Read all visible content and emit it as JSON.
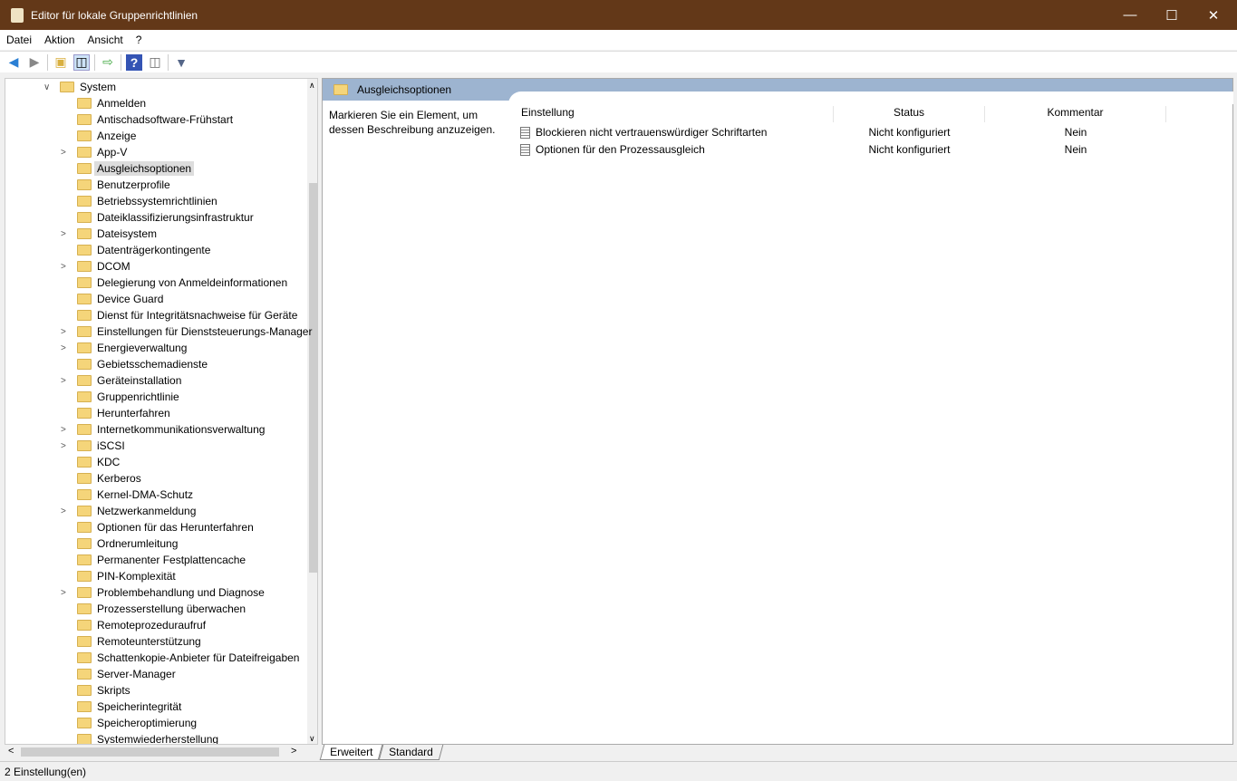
{
  "window": {
    "title": "Editor für lokale Gruppenrichtlinien"
  },
  "menu": [
    "Datei",
    "Aktion",
    "Ansicht",
    "?"
  ],
  "tree": {
    "root": "System",
    "items": [
      {
        "label": "Anmelden",
        "expandable": false
      },
      {
        "label": "Antischadsoftware-Frühstart",
        "expandable": false
      },
      {
        "label": "Anzeige",
        "expandable": false
      },
      {
        "label": "App-V",
        "expandable": true
      },
      {
        "label": "Ausgleichsoptionen",
        "expandable": false,
        "selected": true
      },
      {
        "label": "Benutzerprofile",
        "expandable": false
      },
      {
        "label": "Betriebssystemrichtlinien",
        "expandable": false
      },
      {
        "label": "Dateiklassifizierungsinfrastruktur",
        "expandable": false
      },
      {
        "label": "Dateisystem",
        "expandable": true
      },
      {
        "label": "Datenträgerkontingente",
        "expandable": false
      },
      {
        "label": "DCOM",
        "expandable": true
      },
      {
        "label": "Delegierung von Anmeldeinformationen",
        "expandable": false
      },
      {
        "label": "Device Guard",
        "expandable": false
      },
      {
        "label": "Dienst für Integritätsnachweise für Geräte",
        "expandable": false
      },
      {
        "label": "Einstellungen für Dienststeuerungs-Manager",
        "expandable": true
      },
      {
        "label": "Energieverwaltung",
        "expandable": true
      },
      {
        "label": "Gebietsschemadienste",
        "expandable": false
      },
      {
        "label": "Geräteinstallation",
        "expandable": true
      },
      {
        "label": "Gruppenrichtlinie",
        "expandable": false
      },
      {
        "label": "Herunterfahren",
        "expandable": false
      },
      {
        "label": "Internetkommunikationsverwaltung",
        "expandable": true
      },
      {
        "label": "iSCSI",
        "expandable": true
      },
      {
        "label": "KDC",
        "expandable": false
      },
      {
        "label": "Kerberos",
        "expandable": false
      },
      {
        "label": "Kernel-DMA-Schutz",
        "expandable": false
      },
      {
        "label": "Netzwerkanmeldung",
        "expandable": true
      },
      {
        "label": "Optionen für das Herunterfahren",
        "expandable": false
      },
      {
        "label": "Ordnerumleitung",
        "expandable": false
      },
      {
        "label": "Permanenter Festplattencache",
        "expandable": false
      },
      {
        "label": "PIN-Komplexität",
        "expandable": false
      },
      {
        "label": "Problembehandlung und Diagnose",
        "expandable": true
      },
      {
        "label": "Prozesserstellung überwachen",
        "expandable": false
      },
      {
        "label": "Remoteprozeduraufruf",
        "expandable": false
      },
      {
        "label": "Remoteunterstützung",
        "expandable": false
      },
      {
        "label": "Schattenkopie-Anbieter für Dateifreigaben",
        "expandable": false
      },
      {
        "label": "Server-Manager",
        "expandable": false
      },
      {
        "label": "Skripts",
        "expandable": false
      },
      {
        "label": "Speicherintegrität",
        "expandable": false
      },
      {
        "label": "Speicheroptimierung",
        "expandable": false
      },
      {
        "label": "Systemwiederherstellung",
        "expandable": false
      }
    ]
  },
  "main": {
    "header": "Ausgleichsoptionen",
    "description": "Markieren Sie ein Element, um dessen Beschreibung anzuzeigen.",
    "columns": [
      "Einstellung",
      "Status",
      "Kommentar"
    ],
    "rows": [
      {
        "setting": "Blockieren nicht vertrauenswürdiger Schriftarten",
        "status": "Nicht konfiguriert",
        "comment": "Nein"
      },
      {
        "setting": "Optionen für den Prozessausgleich",
        "status": "Nicht konfiguriert",
        "comment": "Nein"
      }
    ]
  },
  "tabs": [
    "Erweitert",
    "Standard"
  ],
  "status": "2 Einstellung(en)"
}
